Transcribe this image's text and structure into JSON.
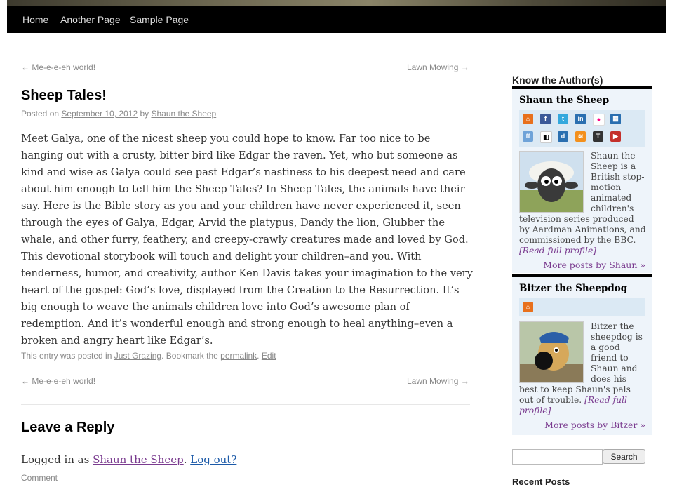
{
  "nav": {
    "items": [
      "Home",
      "Another Page",
      "Sample Page"
    ]
  },
  "post_nav": {
    "prev": "← Me-e-e-eh world!",
    "next": "Lawn Mowing →"
  },
  "post": {
    "title": "Sheep Tales!",
    "meta_prefix": "Posted on ",
    "date": "September 10, 2012",
    "meta_by": " by ",
    "author": "Shaun the Sheep",
    "body": "Meet Galya, one of the nicest sheep you could hope to know. Far too nice to be hanging out with a crusty, bitter bird like Edgar the raven. Yet, who but someone as kind and wise as Galya could see past Edgar’s nastiness to his deepest need and care about him enough to tell him the Sheep Tales? In Sheep Tales, the animals have their say. Here is the Bible story as you and your children have never experienced it, seen through the eyes of Galya, Edgar, Arvid the platypus, Dandy the lion, Glubber the whale, and other furry, feathery, and creepy-crawly creatures made and loved by God. This devotional storybook will touch and delight your children–and you. With tenderness, humor, and creativity, author Ken Davis takes your imagination to the very heart of the gospel: God’s love, displayed from the Creation to the Resurrection. It’s big enough to weave the animals children love into God’s awesome plan of redemption. And it’s wonderful enough and strong enough to heal anything–even a broken and angry heart like Edgar’s.",
    "footer_prefix": "This entry was posted in ",
    "category": "Just Grazing",
    "footer_mid": ". Bookmark the ",
    "permalink": "permalink",
    "footer_sep": ". ",
    "edit": "Edit"
  },
  "reply": {
    "title": "Leave a Reply",
    "logged_prefix": "Logged in as ",
    "user": "Shaun the Sheep",
    "sep": ". ",
    "logout": "Log out?",
    "comment_label": "Comment"
  },
  "sidebar": {
    "widget_title": "Know the Author(s)",
    "authors": [
      {
        "name": "Shaun the Sheep",
        "icons": [
          "home-icon",
          "facebook-icon",
          "twitter-icon",
          "linkedin-icon",
          "flickr-icon",
          "delicious-icon",
          "friendfeed-icon",
          "delicious-squares-icon",
          "digg-icon",
          "rss-icon",
          "tumblr-icon",
          "youtube-icon"
        ],
        "bio": "Shaun the Sheep is a British stop-motion animated children's television series produced by Aardman Animations, and commissioned by the BBC.",
        "read_more": "[Read full profile]",
        "more_posts": "More posts by Shaun »"
      },
      {
        "name": "Bitzer the Sheepdog",
        "icons": [
          "home-icon"
        ],
        "bio": "Bitzer the sheepdog is a good friend to Shaun and does his best to keep Shaun's pals out of trouble.",
        "read_more": "[Read full profile]",
        "more_posts": "More posts by Bitzer »"
      }
    ],
    "search_button": "Search",
    "recent_posts_title": "Recent Posts"
  },
  "colors": {
    "nav_bg": "#000000",
    "sidebar_box": "#eef4fa",
    "link_visited": "#7a3b8f",
    "link": "#1c5aa8"
  }
}
